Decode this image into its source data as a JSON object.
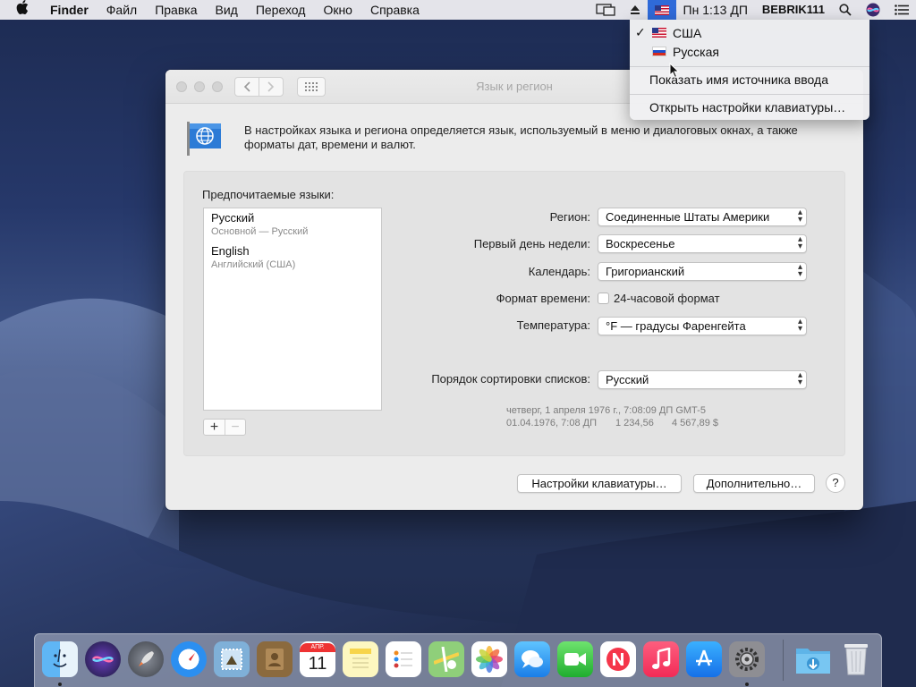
{
  "menubar": {
    "app_name": "Finder",
    "menus": [
      "Файл",
      "Правка",
      "Вид",
      "Переход",
      "Окно",
      "Справка"
    ],
    "clock": "Пн 1:13 ДП",
    "user": "BEBRIK111"
  },
  "input_menu": {
    "items": [
      {
        "label": "США",
        "checked": true,
        "flag": "us-flag"
      },
      {
        "label": "Русская",
        "checked": false,
        "flag": "ru-flag"
      }
    ],
    "check_mark": "✓",
    "show_input_source_name": "Показать имя источника ввода",
    "open_keyboard_prefs": "Открыть настройки клавиатуры…"
  },
  "window": {
    "title": "Язык и регион",
    "description": "В настройках языка и региона определяется язык, используемый в меню и диалоговых окнах, а также форматы дат, времени и валют.",
    "preferred_languages_title": "Предпочитаемые языки:",
    "languages": [
      {
        "name": "Русский",
        "subtitle": "Основной — Русский"
      },
      {
        "name": "English",
        "subtitle": "Английский (США)"
      }
    ],
    "add_label": "+",
    "remove_label": "−",
    "settings": {
      "region_label": "Регион:",
      "region_value": "Соединенные Штаты Америки",
      "first_day_label": "Первый день недели:",
      "first_day_value": "Воскресенье",
      "calendar_label": "Календарь:",
      "calendar_value": "Григорианский",
      "time_format_label": "Формат времени:",
      "time_format_checkbox": "24-часовой формат",
      "time_format_checked": false,
      "temperature_label": "Температура:",
      "temperature_value": "°F — градусы Фаренгейта",
      "sort_order_label": "Порядок сортировки списков:",
      "sort_order_value": "Русский"
    },
    "sample_line1": "четверг, 1 апреля 1976 г., 7:08:09 ДП GMT-5",
    "sample_date_short": "01.04.1976, 7:08 ДП",
    "sample_number": "1 234,56",
    "sample_currency": "4 567,89 $",
    "keyboard_prefs_button": "Настройки клавиатуры…",
    "advanced_button": "Дополнительно…",
    "help_button": "?"
  },
  "dock": {
    "calendar_month": "АПР.",
    "calendar_day": "11"
  },
  "colors": {
    "accent": "#2f6ad9",
    "menubar_bg": "#ececf0",
    "window_bg": "#ececec"
  }
}
